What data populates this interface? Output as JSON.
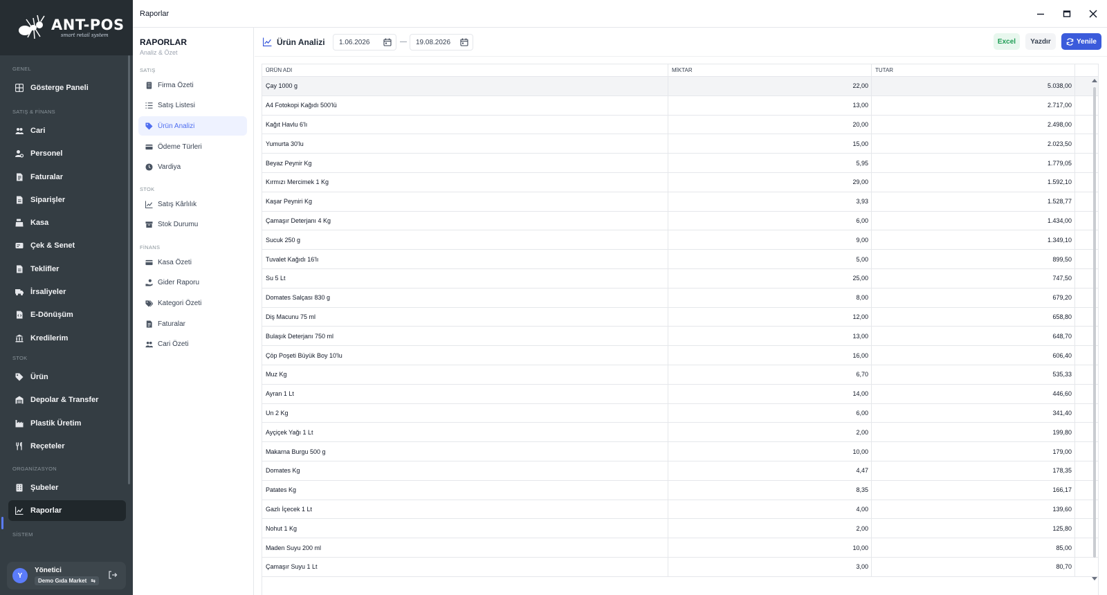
{
  "app": {
    "logo_title": "ANT-POS",
    "logo_subtitle": "smart retail system",
    "window_title": "Raporlar"
  },
  "sidebar": {
    "sections": {
      "genel": "GENEL",
      "satis_finans": "SATIŞ & FİNANS",
      "stok": "STOK",
      "organizasyon": "ORGANİZASYON",
      "sistem": "SİSTEM"
    },
    "items": [
      {
        "label": "Gösterge Paneli",
        "icon": "dashboard-icon"
      },
      {
        "label": "Cari",
        "icon": "users-icon"
      },
      {
        "label": "Personel",
        "icon": "user-cog-icon"
      },
      {
        "label": "Faturalar",
        "icon": "invoice-icon"
      },
      {
        "label": "Siparişler",
        "icon": "order-icon"
      },
      {
        "label": "Kasa",
        "icon": "cash-register-icon"
      },
      {
        "label": "Çek & Senet",
        "icon": "money-check-icon"
      },
      {
        "label": "Teklifler",
        "icon": "file-icon"
      },
      {
        "label": "İrsaliyeler",
        "icon": "truck-icon"
      },
      {
        "label": "E-Dönüşüm",
        "icon": "file-code-icon"
      },
      {
        "label": "Kredilerim",
        "icon": "bank-icon"
      },
      {
        "label": "Ürün",
        "icon": "tag-icon"
      },
      {
        "label": "Depolar & Transfer",
        "icon": "warehouse-icon"
      },
      {
        "label": "Plastik Üretim",
        "icon": "industry-icon"
      },
      {
        "label": "Reçeteler",
        "icon": "utensils-icon"
      },
      {
        "label": "Şubeler",
        "icon": "building-icon"
      },
      {
        "label": "Raporlar",
        "icon": "chart-line-icon"
      }
    ],
    "user": {
      "initial": "Y",
      "name": "Yönetici",
      "store": "Demo Gıda Market"
    }
  },
  "reports_nav": {
    "title": "RAPORLAR",
    "subtitle": "Analiz & Özet",
    "sections": {
      "satis": "SATIŞ",
      "stok": "STOK",
      "finans": "FİNANS"
    },
    "items": [
      {
        "label": "Firma Özeti",
        "icon": "building-icon"
      },
      {
        "label": "Satış Listesi",
        "icon": "list-icon"
      },
      {
        "label": "Ürün Analizi",
        "icon": "tag-icon"
      },
      {
        "label": "Ödeme Türleri",
        "icon": "credit-card-icon"
      },
      {
        "label": "Vardiya",
        "icon": "clock-icon"
      },
      {
        "label": "Satış Kârlılık",
        "icon": "chart-line-icon"
      },
      {
        "label": "Stok Durumu",
        "icon": "box-icon"
      },
      {
        "label": "Kasa Özeti",
        "icon": "cash-register-icon"
      },
      {
        "label": "Gider Raporu",
        "icon": "hand-money-icon"
      },
      {
        "label": "Kategori Özeti",
        "icon": "tags-icon"
      },
      {
        "label": "Faturalar",
        "icon": "invoice-icon"
      },
      {
        "label": "Cari Özeti",
        "icon": "users-icon"
      }
    ]
  },
  "toolbar": {
    "title": "Ürün Analizi",
    "date_start": "1.06.2026",
    "date_end": "19.08.2026",
    "excel_label": "Excel",
    "print_label": "Yazdır",
    "refresh_label": "Yenile"
  },
  "table": {
    "headers": [
      "ÜRÜN ADI",
      "MİKTAR",
      "TUTAR"
    ],
    "rows": [
      [
        "Çay 1000 g",
        "22,00",
        "5.038,00"
      ],
      [
        "A4 Fotokopi Kağıdı 500'lü",
        "13,00",
        "2.717,00"
      ],
      [
        "Kağıt Havlu 6'lı",
        "20,00",
        "2.498,00"
      ],
      [
        "Yumurta 30'lu",
        "15,00",
        "2.023,50"
      ],
      [
        "Beyaz Peynir Kg",
        "5,95",
        "1.779,05"
      ],
      [
        "Kırmızı Mercimek 1 Kg",
        "29,00",
        "1.592,10"
      ],
      [
        "Kaşar Peyniri Kg",
        "3,93",
        "1.528,77"
      ],
      [
        "Çamaşır Deterjanı 4 Kg",
        "6,00",
        "1.434,00"
      ],
      [
        "Sucuk 250 g",
        "9,00",
        "1.349,10"
      ],
      [
        "Tuvalet Kağıdı 16'lı",
        "5,00",
        "899,50"
      ],
      [
        "Su 5 Lt",
        "25,00",
        "747,50"
      ],
      [
        "Domates Salçası 830 g",
        "8,00",
        "679,20"
      ],
      [
        "Diş Macunu 75 ml",
        "12,00",
        "658,80"
      ],
      [
        "Bulaşık Deterjanı 750 ml",
        "13,00",
        "648,70"
      ],
      [
        "Çöp Poşeti Büyük Boy 10'lu",
        "16,00",
        "606,40"
      ],
      [
        "Muz Kg",
        "6,70",
        "535,33"
      ],
      [
        "Ayran 1 Lt",
        "14,00",
        "446,60"
      ],
      [
        "Un 2 Kg",
        "6,00",
        "341,40"
      ],
      [
        "Ayçiçek Yağı 1 Lt",
        "2,00",
        "199,80"
      ],
      [
        "Makarna Burgu 500 g",
        "10,00",
        "179,00"
      ],
      [
        "Domates Kg",
        "4,47",
        "178,35"
      ],
      [
        "Patates Kg",
        "8,35",
        "166,17"
      ],
      [
        "Gazlı İçecek 1 Lt",
        "4,00",
        "139,60"
      ],
      [
        "Nohut 1 Kg",
        "2,00",
        "125,80"
      ],
      [
        "Maden Suyu 200 ml",
        "10,00",
        "85,00"
      ],
      [
        "Çamaşır Suyu 1 Lt",
        "3,00",
        "80,70"
      ]
    ]
  },
  "colors": {
    "sidebar_bg": "#343d43",
    "accent": "#3b5bdb",
    "excel_green": "#1f9d55"
  }
}
